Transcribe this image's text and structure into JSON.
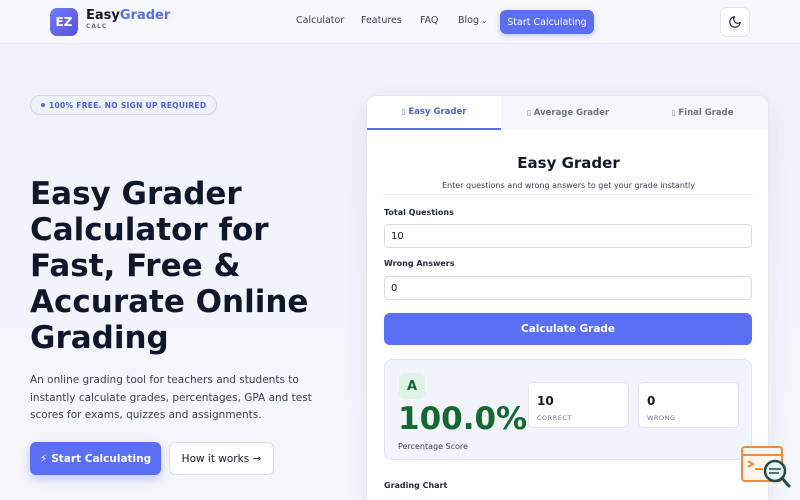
{
  "header": {
    "logo_badge": "EZ",
    "logo_word1": "Easy",
    "logo_word2": "Grader",
    "logo_sub": "CALC",
    "nav": [
      "Calculator",
      "Features",
      "FAQ",
      "Blog"
    ],
    "cta": "Start Calculating",
    "theme_icon": "moon-icon"
  },
  "hero": {
    "badge": "100% FREE. NO SIGN UP REQUIRED",
    "title_lines": [
      "Easy Grader",
      "Calculator for",
      "Fast, Free &",
      "Accurate Online",
      "Grading"
    ],
    "description": "An online grading tool for teachers and students to instantly calculate grades, percentages, GPA and test scores for exams, quizzes and assignments.",
    "primary_btn": "Start Calculating",
    "primary_btn_icon": "⚡",
    "secondary_btn": "How it works →"
  },
  "card": {
    "tabs": [
      "Easy Grader",
      "Average Grader",
      "Final Grade"
    ],
    "tab_icon": "▯",
    "title": "Easy Grader",
    "subtitle": "Enter questions and wrong answers to get your grade instantly",
    "total_label": "Total Questions",
    "total_value": "10",
    "wrong_label": "Wrong Answers",
    "wrong_value": "0",
    "calc_btn": "Calculate Grade",
    "result": {
      "grade": "A",
      "percent": "100.0%",
      "percent_label": "Percentage Score",
      "correct_num": "10",
      "correct_label": "CORRECT",
      "wrong_num": "0",
      "wrong_label": "WRONG"
    },
    "chart_label": "Grading Chart"
  },
  "colors": {
    "accent": "#5b6ff5",
    "grade_green": "#15692f",
    "widget_orange": "#f08a3c"
  }
}
